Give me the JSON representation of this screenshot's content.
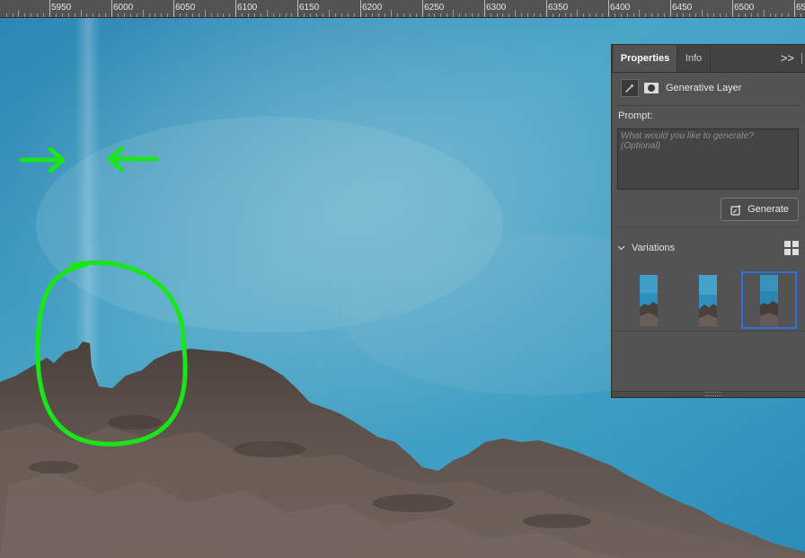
{
  "ruler": {
    "labels": [
      "5950",
      "6000",
      "6050",
      "6100",
      "6150",
      "6200",
      "6250",
      "6300",
      "6350",
      "6400",
      "6450",
      "6500",
      "65"
    ]
  },
  "panel": {
    "tabs": [
      {
        "label": "Properties",
        "active": true
      },
      {
        "label": "Info",
        "active": false
      }
    ],
    "overflow_glyph": ">>",
    "layer_name": "Generative Layer",
    "prompt_label": "Prompt:",
    "prompt_placeholder": "What would you like to generate? (Optional)",
    "prompt_value": "",
    "generate_label": "Generate",
    "variations_label": "Variations",
    "variations": [
      {
        "selected": false
      },
      {
        "selected": false
      },
      {
        "selected": true
      }
    ]
  },
  "colors": {
    "sky": "#3d9ec2",
    "rock": "#5b4e49",
    "annotation": "#19e619",
    "selection": "#2f6fe0"
  },
  "icons": {
    "layer_type": "generative-sparkle-icon",
    "mask": "layer-mask-icon",
    "generate": "generate-sparkle-icon",
    "collapse": "chevron-down-icon",
    "grid": "grid-view-icon"
  }
}
